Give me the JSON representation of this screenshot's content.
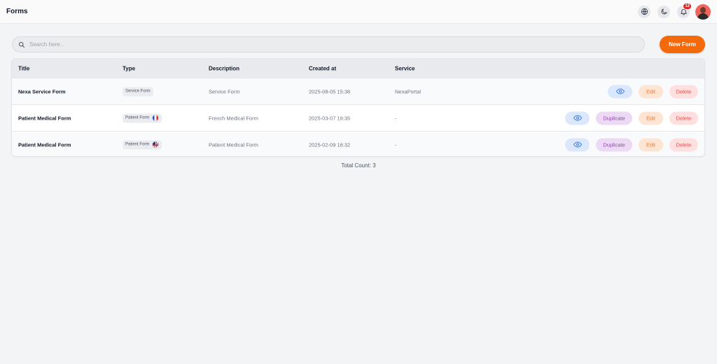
{
  "header": {
    "title": "Forms",
    "notification_count": "12"
  },
  "search": {
    "placeholder": "Search here..."
  },
  "new_form_label": "New Form",
  "table": {
    "columns": [
      "Title",
      "Type",
      "Description",
      "Created at",
      "Service"
    ],
    "rows": [
      {
        "title": "Nexa Service Form",
        "type": "Service Form",
        "flag": "",
        "description": "Service Form",
        "created_at": "2025-08-05 15:38",
        "service": "NexaPortal"
      },
      {
        "title": "Patient Medical Form",
        "type": "Patient Form",
        "flag": "france-flag",
        "description": "French Medical Form",
        "created_at": "2025-03-07 16:35",
        "service": "-"
      },
      {
        "title": "Patient Medical Form",
        "type": "Patient Form",
        "flag": "uk-flag",
        "description": "Patient Medical Form",
        "created_at": "2025-02-09 16:32",
        "service": "-"
      }
    ]
  },
  "actions": {
    "duplicate": "Duplicate",
    "edit": "Edit",
    "delete": "Delete"
  },
  "total_count": "Total Count: 3",
  "colors": {
    "accent": "#f46a0b",
    "view_bg": "#dbe7fb",
    "duplicate_bg": "#ecd9f4",
    "edit_bg": "#fde4d3",
    "delete_bg": "#fde0df"
  }
}
